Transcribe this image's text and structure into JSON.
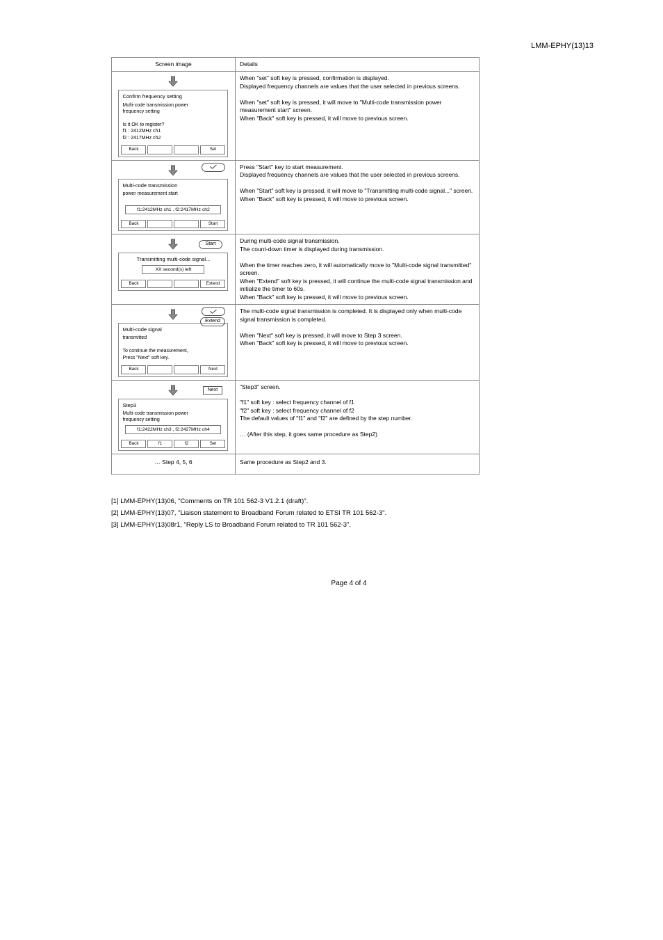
{
  "header": "LMM-EPHY(13)13",
  "table": {
    "head_left": "Screen image",
    "head_right": "Details"
  },
  "steps": [
    {
      "trans_label": "",
      "panel_title": "Confirm frequency setting",
      "panel_lines": [
        "Multi-code transmission power",
        "frequency setting",
        "",
        "Is it OK to register?",
        "    f1 : 2412MHz ch1",
        "    f2 : 2417MHz ch2"
      ],
      "foot": [
        "Back",
        "",
        "",
        "Set"
      ],
      "right": "When \"set\" soft key is pressed, confirmation is displayed.\nDisplayed frequency channels are values that the user selected in previous screens.\n\nWhen \"set\" soft key is pressed, it will move to \"Multi-code transmission power measurement start\" screen.\nWhen \"Back\" soft key is pressed, it will move to previous screen."
    },
    {
      "trans_label_icon": "set",
      "panel_title": "Multi-code transmission",
      "panel_lines": [
        "power measurement start",
        ""
      ],
      "panel_box": "f1:2412MHz ch1 , f2:2417MHz ch2",
      "panel_box_wide": true,
      "foot": [
        "Back",
        "",
        "",
        "Start"
      ],
      "right": "Press \"Start\" key to start measurement.\nDisplayed frequency channels are values that the user selected in previous screens.\n\nWhen \"Start\" soft key is pressed, it will move to \"Transmitting multi-code signal...\" screen.\nWhen \"Back\" soft key is pressed, it will move to previous screen."
    },
    {
      "trans_label": "Start",
      "panel_title": "Transmitting multi-code signal...",
      "panel_box": "XX second(s) left",
      "panel_box_narrow": true,
      "panel_center": true,
      "foot": [
        "Back",
        "",
        "",
        "Extend"
      ],
      "right": "During multi-code signal transmission.\nThe count-down timer is displayed during transmission.\n\nWhen the timer reaches zero, it will automatically move to \"Multi-code signal transmitted\" screen.\nWhen \"Extend\" soft key is pressed, it will continue the multi-code signal transmission and initialize the timer to 60s.\nWhen \"Back\" soft key is pressed, it will move to previous screen."
    },
    {
      "trans_label_icon": "set",
      "trans_label2": "Extend",
      "panel_title": "Multi-code signal",
      "panel_lines": [
        "transmitted",
        "",
        "To continue the measurement,",
        "Press \"Next\" soft key."
      ],
      "panel_left": true,
      "foot": [
        "Back",
        "",
        "",
        "Next"
      ],
      "right": "The multi-code signal transmission is completed. It is displayed only when multi-code signal transmission is completed.\n\nWhen \"Next\" soft key is pressed, it will move to Step 3 screen.\nWhen \"Back\" soft key is pressed, it will move to previous screen."
    },
    {
      "trans_label_sq": "Next",
      "panel_title": "Step3",
      "panel_lines": [
        "Multi-code transmission power",
        "frequency setting"
      ],
      "panel_box": "f1:2422MHz ch3 , f2:2427MHz ch4",
      "panel_box_wide": true,
      "foot": [
        "Back",
        "f1",
        "f2",
        "Set"
      ],
      "right": "\"Step3\" screen.\n\n\"f1\" soft key : select frequency channel of f1\n\"f2\" soft key : select frequency channel of f2\nThe default values of \"f1\" and \"f2\" are defined by the step number.\n\n… (After this step, it goes same procedure as Step2)"
    }
  ],
  "note": {
    "left": "… Step 4, 5, 6",
    "right": "Same procedure as Step2 and 3."
  },
  "refs": [
    "[1]   LMM-EPHY(13)06, \"Comments on TR 101 562-3 V1.2.1 (draft)\".",
    "[2]   LMM-EPHY(13)07, \"Liaison statement to Broadband Forum related to ETSI TR 101 562-3\".",
    "[3]   LMM-EPHY(13)08r1, \"Reply LS to Broadband Forum related to TR 101 562-3\"."
  ],
  "footer": "Page 4 of 4"
}
